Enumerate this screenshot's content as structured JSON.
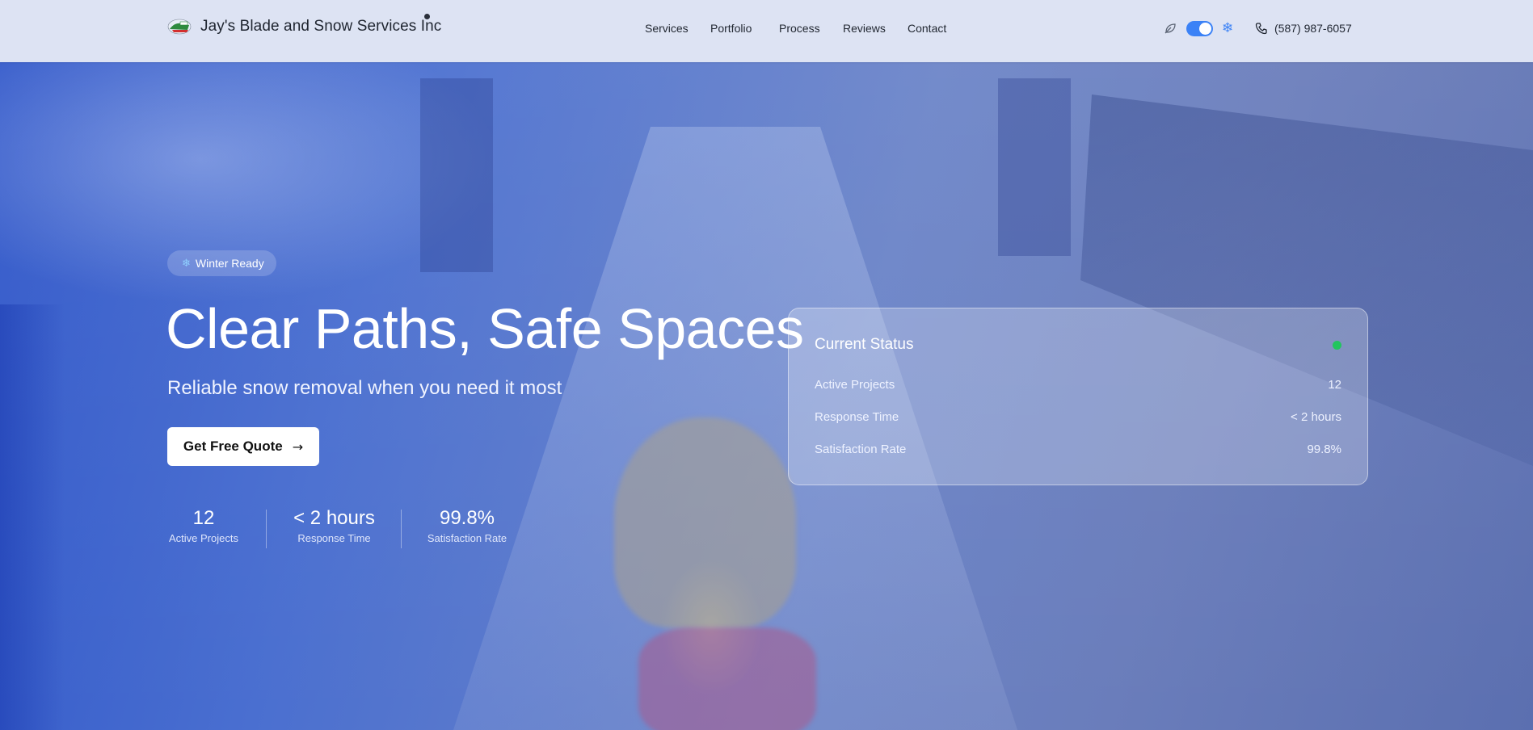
{
  "header": {
    "brand": "Jay's Blade and Snow Services Inc",
    "logo_icon": "snowplow-logo-icon",
    "nav": [
      {
        "label": "Services"
      },
      {
        "label": "Portfolio"
      },
      {
        "label": "Process"
      },
      {
        "label": "Reviews"
      },
      {
        "label": "Contact"
      }
    ],
    "theme_toggle": {
      "left_icon": "leaf-icon",
      "right_icon": "snowflake-icon",
      "on": true
    },
    "phone": "(587) 987-6057",
    "accent_color": "#3b82f6"
  },
  "hero": {
    "badge": "Winter Ready",
    "title": "Clear Paths, Safe Spaces",
    "subtitle": "Reliable snow removal when you need it most",
    "cta_label": "Get Free Quote",
    "stats": [
      {
        "value": "12",
        "label": "Active Projects"
      },
      {
        "value": "< 2 hours",
        "label": "Response Time"
      },
      {
        "value": "99.8%",
        "label": "Satisfaction Rate"
      }
    ]
  },
  "status_card": {
    "title": "Current Status",
    "indicator_color": "#22c55e",
    "rows": [
      {
        "label": "Active Projects",
        "value": "12"
      },
      {
        "label": "Response Time",
        "value": "< 2 hours"
      },
      {
        "label": "Satisfaction Rate",
        "value": "99.8%"
      }
    ]
  }
}
